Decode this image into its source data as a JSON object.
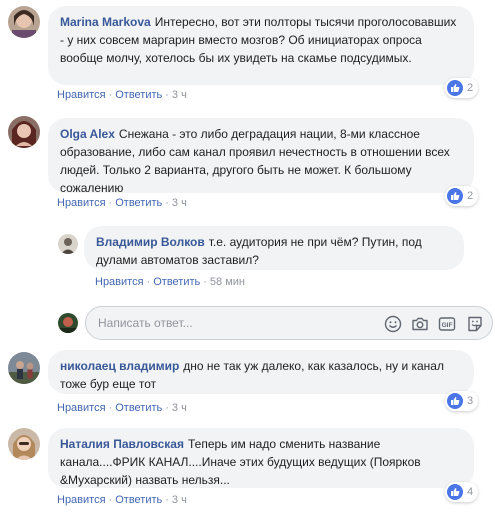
{
  "comments": [
    {
      "author": "Marina Markova",
      "text": "Интересно, вот эти полторы тысячи проголосовавших - у них совсем маргарин вместо мозгов? Об инициаторах опроса вообще молчу, хотелось бы их увидеть на скамье подсудимых.",
      "like": "Нравится",
      "reply": "Ответить",
      "time": "3 ч",
      "reactions": "2"
    },
    {
      "author": "Olga Alex",
      "text": "Снежана - это либо деградация нации, 8-ми классное образование, либо сам канал проявил нечестность в отношении всех людей. Только 2 варианта, другого быть не может. К большому сожалению",
      "like": "Нравится",
      "reply": "Ответить",
      "time": "3 ч",
      "reactions": "2"
    },
    {
      "author": "Владимир Волков",
      "text": "т.е. аудитория не при чём? Путин, под дулами автоматов заставил?",
      "like": "Нравится",
      "reply": "Ответить",
      "time": "58 мин"
    },
    {
      "author": "николаец владимир",
      "text": "дно не так уж далеко, как казалось, ну и канал тоже бур еще тот",
      "like": "Нравится",
      "reply": "Ответить",
      "time": "3 ч",
      "reactions": "3"
    },
    {
      "author": "Наталия Павловская",
      "text": "Теперь им надо сменить название канала....ФРИК КАНАЛ....Иначе этих будущих ведущих (Поярков &Мухарский) назвать нельзя...",
      "like": "Нравится",
      "reply": "Ответить",
      "time": "3 ч",
      "reactions": "4"
    }
  ],
  "reply_box": {
    "placeholder": "Написать ответ...",
    "gif_label": "GIF"
  },
  "colors": {
    "author": "#385898",
    "link": "#4267b2",
    "bubble": "#f2f3f5",
    "like_badge": "#4a76e8"
  },
  "icons": [
    "emoji-icon",
    "camera-icon",
    "gif-icon",
    "sticker-icon",
    "like-icon"
  ]
}
